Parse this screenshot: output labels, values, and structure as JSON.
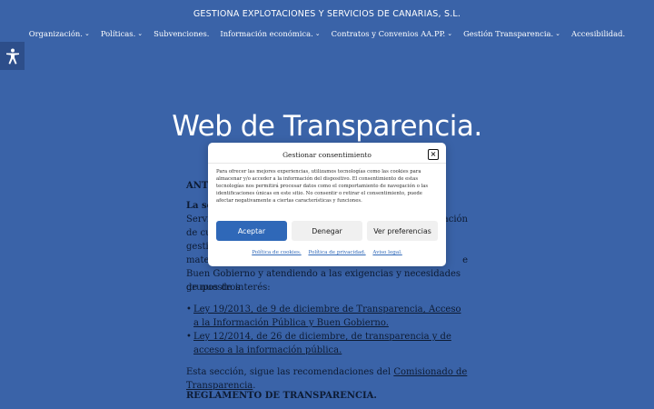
{
  "header": {
    "site_title": "GESTIONA EXPLOTACIONES Y SERVICIOS DE CANARIAS, S.L.",
    "nav": [
      {
        "label": "Organización.",
        "has_submenu": true
      },
      {
        "label": "Políticas.",
        "has_submenu": true
      },
      {
        "label": "Subvenciones.",
        "has_submenu": false
      },
      {
        "label": "Información económica.",
        "has_submenu": true
      },
      {
        "label": "Contratos y Convenios AA.PP.",
        "has_submenu": true
      },
      {
        "label": "Gestión Transparencia.",
        "has_submenu": true
      },
      {
        "label": "Accesibilidad.",
        "has_submenu": false
      }
    ],
    "submenu_caret": "⌄"
  },
  "hero": {
    "title": "Web de Transparencia."
  },
  "content": {
    "antecedentes_heading": "ANT",
    "main_lines": [
      "La sec",
      "Servic",
      "de cua",
      "gestió",
      "materi",
      "Buen Gobierno y atendiendo a las exigencias y necesidades de nuestros",
      "grupos de interés:"
    ],
    "main_right_fragments": [
      "ación",
      "e"
    ],
    "laws": [
      "Ley 19/2013, de 9 de diciembre de Transparencia, Acceso a la Información Pública y Buen Gobierno.",
      "Ley 12/2014, de 26 de diciembre, de transparencia y de acceso a la información pública."
    ],
    "section_prefix": "Esta sección, sigue las recomendaciones del ",
    "section_link": "Comisionado de Transparencia",
    "section_suffix": ".",
    "reglamento_heading": "REGLAMENTO DE TRANSPARENCIA."
  },
  "consent": {
    "title": "Gestionar consentimiento",
    "close_icon": "×",
    "text": "Para ofrecer las mejores experiencias, utilizamos tecnologías como las cookies para almacenar y/o acceder a la información del dispositivo. El consentimiento de estas tecnologías nos permitirá procesar datos como el comportamiento de navegación o las identificaciones únicas en este sitio. No consentir o retirar el consentimiento, puede afectar negativamente a ciertas características y funciones.",
    "accept": "Aceptar",
    "deny": "Denegar",
    "preferences": "Ver preferencias",
    "links": [
      "Política de cookies.",
      "Política de privacidad.",
      "Aviso legal."
    ],
    "accept_color": "#2f68b8"
  },
  "colors": {
    "background": "#3a63a8",
    "text_dark": "#0d1b33"
  }
}
